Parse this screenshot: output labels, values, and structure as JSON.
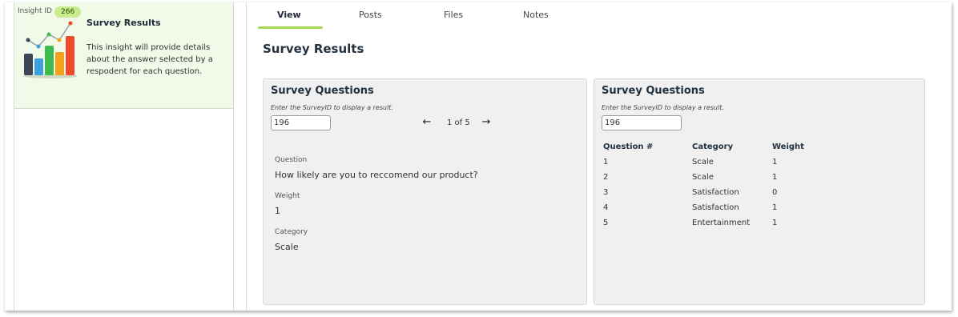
{
  "insight": {
    "id_label": "Insight ID",
    "id_value": "266",
    "title": "Survey Results",
    "description": "This insight will provide details about the answer selected by a respodent for each question."
  },
  "tabs": [
    {
      "label": "View",
      "active": true
    },
    {
      "label": "Posts",
      "active": false
    },
    {
      "label": "Files",
      "active": false
    },
    {
      "label": "Notes",
      "active": false
    }
  ],
  "page_title": "Survey Results",
  "left_card": {
    "title": "Survey Questions",
    "hint": "Enter the SurveyID to display a result.",
    "survey_id": "196",
    "pager": {
      "prev_icon": "arrow-left-icon",
      "text": "1 of 5",
      "next_icon": "arrow-right-icon"
    },
    "question_label": "Question",
    "question_value": "How likely are you to reccomend our product?",
    "weight_label": "Weight",
    "weight_value": "1",
    "category_label": "Category",
    "category_value": "Scale"
  },
  "right_card": {
    "title": "Survey Questions",
    "hint": "Enter the SurveyID to display a result.",
    "survey_id": "196",
    "columns": [
      "Question #",
      "Category",
      "Weight"
    ],
    "rows": [
      [
        "1",
        "Scale",
        "1"
      ],
      [
        "2",
        "Scale",
        "1"
      ],
      [
        "3",
        "Satisfaction",
        "0"
      ],
      [
        "4",
        "Satisfaction",
        "1"
      ],
      [
        "5",
        "Entertainment",
        "1"
      ]
    ]
  },
  "colors": {
    "accent": "#a6d94f",
    "card_bg": "#f1f9e8",
    "badge": "#c9ec8f",
    "chart_bars": [
      "#3b4656",
      "#3aa0e0",
      "#3dbb4e",
      "#f4a11a",
      "#ee4b2b"
    ]
  }
}
